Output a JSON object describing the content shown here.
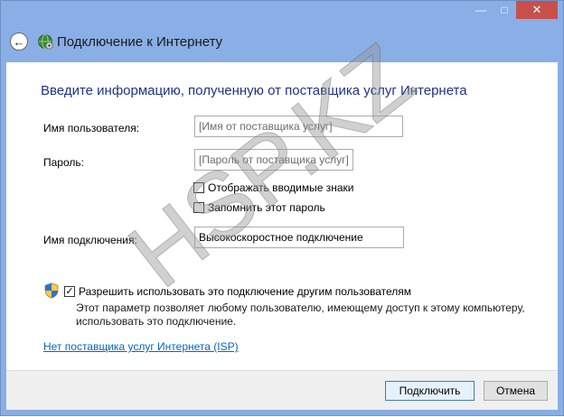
{
  "window": {
    "title": "Подключение к Интернету",
    "caption_buttons": {
      "minimize": "—",
      "maximize": "□",
      "close": "✕"
    }
  },
  "form": {
    "heading": "Введите информацию, полученную от поставщика услуг Интернета",
    "username": {
      "label": "Имя пользователя:",
      "placeholder": "[Имя от поставщика услуг]"
    },
    "password": {
      "label": "Пароль:",
      "placeholder": "[Пароль от поставщика услуг]"
    },
    "show_chars": {
      "label": "Отображать вводимые знаки",
      "checked": false
    },
    "remember": {
      "label": "Запомнить этот пароль",
      "checked": false
    },
    "connection_name": {
      "label": "Имя подключения:",
      "value": "Высокоскоростное подключение"
    },
    "allow_others": {
      "label": "Разрешить использовать это подключение другим пользователям",
      "checked": true,
      "check_mark": "✓",
      "description": "Этот параметр позволяет любому пользователю, имеющему доступ к этому компьютеру, использовать это подключение."
    },
    "no_isp_link": "Нет поставщика услуг Интернета (ISP)"
  },
  "buttons": {
    "connect": "Подключить",
    "cancel": "Отмена"
  },
  "watermark": {
    "text": "HSP.KZ"
  },
  "colors": {
    "frame": "#8aaee6",
    "heading": "#1e3287",
    "link": "#0066cc",
    "close": "#c7504b"
  }
}
